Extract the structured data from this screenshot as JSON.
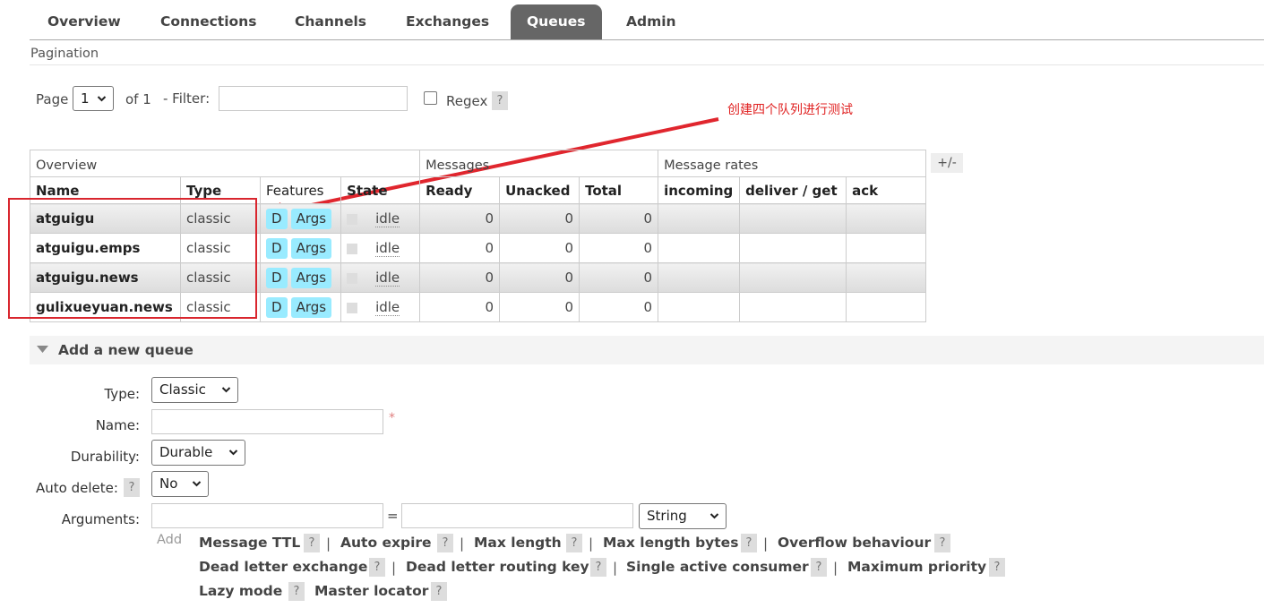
{
  "nav": {
    "tabs": [
      {
        "label": "Overview",
        "active": false
      },
      {
        "label": "Connections",
        "active": false
      },
      {
        "label": "Channels",
        "active": false
      },
      {
        "label": "Exchanges",
        "active": false
      },
      {
        "label": "Queues",
        "active": true
      },
      {
        "label": "Admin",
        "active": false
      }
    ]
  },
  "pagination": {
    "section_label": "Pagination",
    "page_label": "Page",
    "page_value": "1",
    "of_label": "of 1",
    "filter_label": "- Filter:",
    "filter_value": "",
    "regex_label": "Regex",
    "help": "?"
  },
  "table": {
    "groups": {
      "overview": "Overview",
      "messages": "Messages",
      "rates": "Message rates"
    },
    "columns": {
      "name": "Name",
      "type": "Type",
      "features": "Features",
      "state": "State",
      "ready": "Ready",
      "unacked": "Unacked",
      "total": "Total",
      "incoming": "incoming",
      "deliver_get": "deliver / get",
      "ack": "ack"
    },
    "toggle_columns": "+/-",
    "rows": [
      {
        "name": "atguigu",
        "type": "classic",
        "feat_d": "D",
        "feat_args": "Args",
        "state": "idle",
        "ready": "0",
        "unacked": "0",
        "total": "0"
      },
      {
        "name": "atguigu.emps",
        "type": "classic",
        "feat_d": "D",
        "feat_args": "Args",
        "state": "idle",
        "ready": "0",
        "unacked": "0",
        "total": "0"
      },
      {
        "name": "atguigu.news",
        "type": "classic",
        "feat_d": "D",
        "feat_args": "Args",
        "state": "idle",
        "ready": "0",
        "unacked": "0",
        "total": "0"
      },
      {
        "name": "gulixueyuan.news",
        "type": "classic",
        "feat_d": "D",
        "feat_args": "Args",
        "state": "idle",
        "ready": "0",
        "unacked": "0",
        "total": "0"
      }
    ]
  },
  "annotation": {
    "text": "创建四个队列进行测试",
    "color": "#e02020"
  },
  "add_queue": {
    "title": "Add a new queue",
    "type_label": "Type:",
    "type_value": "Classic",
    "name_label": "Name:",
    "name_value": "",
    "required_mark": "*",
    "durability_label": "Durability:",
    "durability_value": "Durable",
    "auto_delete_label": "Auto delete:",
    "auto_delete_value": "No",
    "arguments_label": "Arguments:",
    "arg_equals": "=",
    "arg_type_value": "String",
    "add_label": "Add",
    "help": "?",
    "sep": "|",
    "arg_links": [
      "Message TTL",
      "Auto expire",
      "Max length",
      "Max length bytes",
      "Overflow behaviour",
      "Dead letter exchange",
      "Dead letter routing key",
      "Single active consumer",
      "Maximum priority",
      "Lazy mode",
      "Master locator"
    ]
  }
}
